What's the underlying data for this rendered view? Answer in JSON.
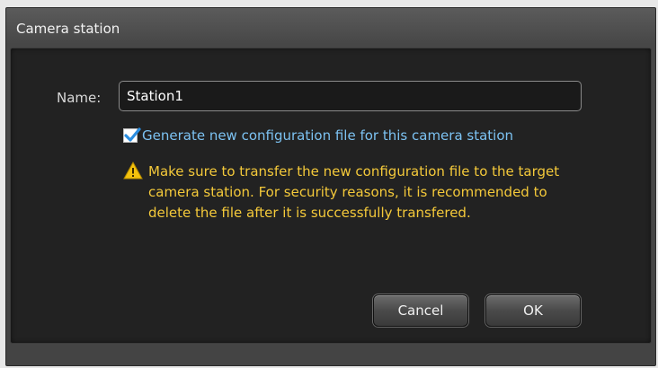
{
  "window": {
    "title": "Camera station"
  },
  "form": {
    "name_label": "Name:",
    "name_value": "Station1",
    "generate_config": {
      "checked": true,
      "label": "Generate new configuration file for this camera station"
    },
    "warning": {
      "icon": "warning-triangle-icon",
      "text": "Make sure to transfer the new configuration file to the target camera station. For security reasons, it is recommended to delete the file after it is successfully transfered."
    }
  },
  "buttons": {
    "cancel_label": "Cancel",
    "ok_label": "OK"
  },
  "colors": {
    "checkbox_label": "#7cc2f2",
    "warning_text": "#f4c93a",
    "check_mark": "#2a8de0"
  }
}
